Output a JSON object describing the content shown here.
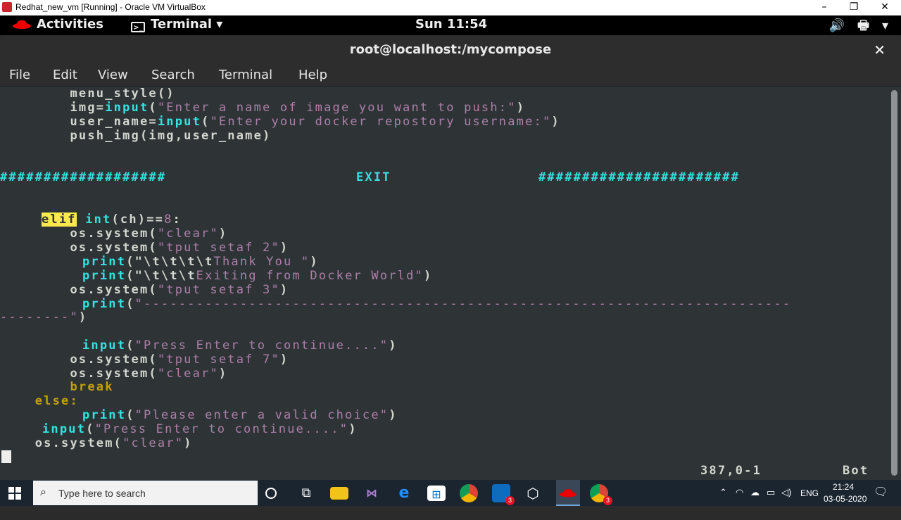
{
  "host_window": {
    "title": "Redhat_new_vm [Running] - Oracle VM VirtualBox",
    "minimize_glyph": "–",
    "restore_glyph": "❐",
    "close_glyph": "✕"
  },
  "gnome_bar": {
    "activities": "Activities",
    "app_menu": "Terminal ▾",
    "clock": "Sun 11:54",
    "volume_glyph": "🔊",
    "battery_glyph": "🖶",
    "menu_glyph": "▾"
  },
  "terminal": {
    "title": "root@localhost:/mycompose",
    "close_glyph": "✕",
    "menu": [
      "File",
      "Edit",
      "View",
      "Search",
      "Terminal",
      "Help"
    ],
    "lines": {
      "l0": "        menu_style()",
      "l1_a": "        img=",
      "l1_kw": "input",
      "l1_b": "(",
      "l1_s": "\"Enter a name of image you want to push:\"",
      "l1_c": ")",
      "l2_a": "        user_name=",
      "l2_kw": "input",
      "l2_b": "(",
      "l2_s": "\"Enter your docker repostory username:\"",
      "l2_c": ")",
      "l3": "        push_img(img,user_name)",
      "l5_a": "###################",
      "l5_b": "EXIT",
      "l5_c": "#######################",
      "l8_kw": "elif",
      "l8_sp": " ",
      "l8_fn": "int",
      "l8_a": "(ch)==",
      "l8_n": "8",
      "l8_b": ":",
      "l9_a": "        os.system(",
      "l9_s": "\"clear\"",
      "l9_b": ")",
      "l10_a": "        os.system(",
      "l10_s": "\"tput setaf 2\"",
      "l10_b": ")",
      "l11_kw": "print",
      "l11_a": "(",
      "l11_s1": "\"\\t\\t\\t\\t",
      "l11_s2": "Thank You \"",
      "l11_b": ")",
      "l12_kw": "print",
      "l12_a": "(",
      "l12_s1": "\"\\t\\t\\t",
      "l12_s2": "Exiting from Docker World\"",
      "l12_b": ")",
      "l13_a": "        os.system(",
      "l13_s": "\"tput setaf 3\"",
      "l13_b": ")",
      "l14_kw": "print",
      "l14_a": "(",
      "l14_s": "\"--------------------------------------------------------------------------",
      "l15_s": "--------\"",
      "l15_b": ")",
      "l17_kw": "input",
      "l17_a": "(",
      "l17_s": "\"Press Enter to continue....\"",
      "l17_b": ")",
      "l18_a": "        os.system(",
      "l18_s": "\"tput setaf 7\"",
      "l18_b": ")",
      "l19_a": "        os.system(",
      "l19_s": "\"clear\"",
      "l19_b": ")",
      "l20": "        break",
      "l21": "    else:",
      "l22_kw": "print",
      "l22_a": "(",
      "l22_s": "\"Please enter a valid choice\"",
      "l22_b": ")",
      "l23_kw": "input",
      "l23_a": "(",
      "l23_s": "\"Press Enter to continue....\"",
      "l23_b": ")",
      "l24_a": "    os.system(",
      "l24_s": "\"clear\"",
      "l24_b": ")"
    },
    "status_position": "387,0-1",
    "status_scroll": "Bot"
  },
  "taskbar": {
    "search_placeholder": "Type here to search",
    "lang": "ENG",
    "time": "21:24",
    "date": "03-05-2020",
    "badge_outlook": "3",
    "badge_chrome2": "3"
  }
}
